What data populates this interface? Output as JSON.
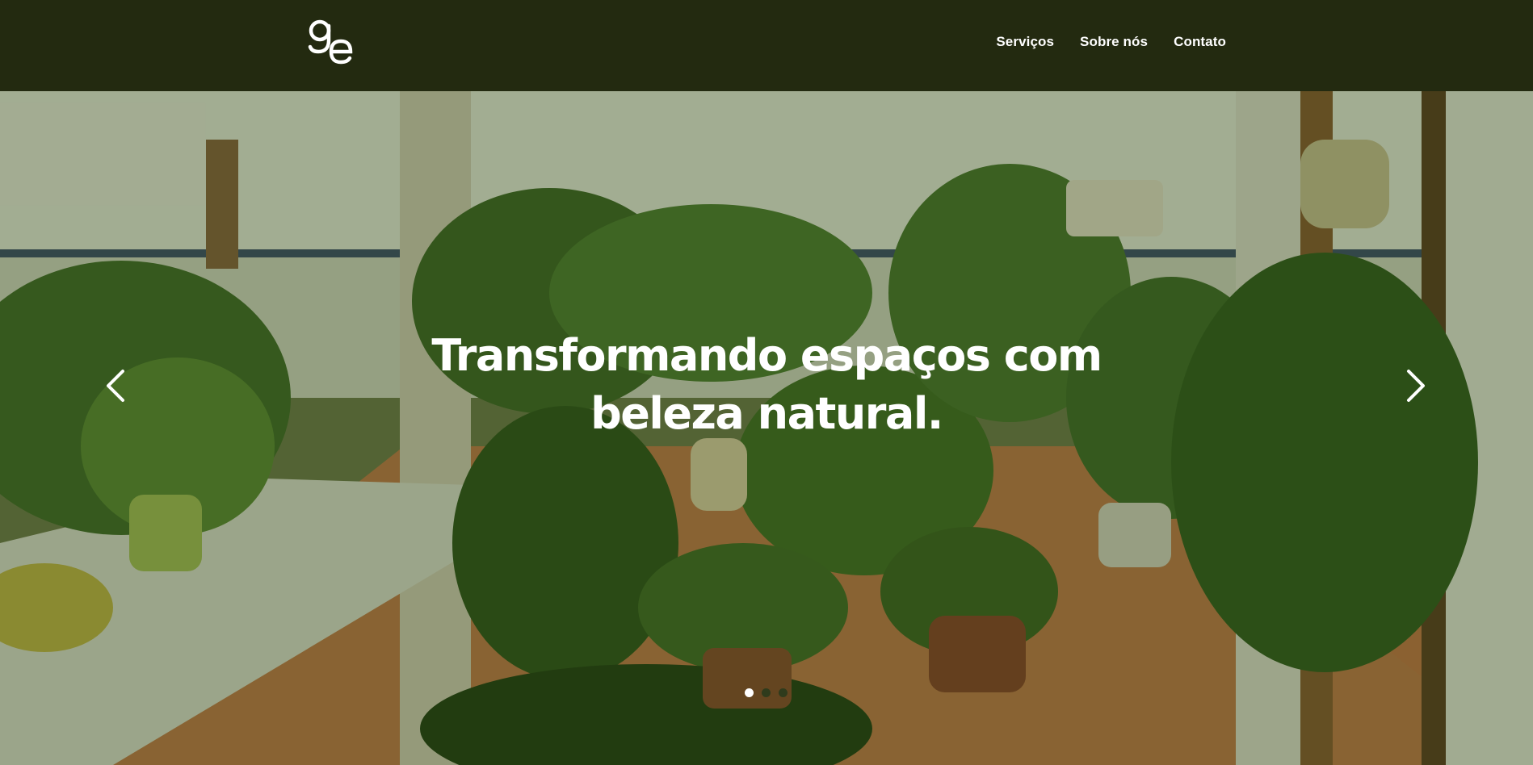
{
  "brand": {
    "logo_icon": "ge-monogram-logo",
    "nav_bg": "#232a10"
  },
  "nav": {
    "items": [
      {
        "label": "Serviços"
      },
      {
        "label": "Sobre nós"
      },
      {
        "label": "Contato"
      }
    ]
  },
  "hero": {
    "title_line1": "Transformando espaços com",
    "title_line2": "beleza natural.",
    "background_image": "courtyard-plants-photo",
    "prev_icon": "chevron-left-icon",
    "next_icon": "chevron-right-icon",
    "slides": [
      {
        "active": true
      },
      {
        "active": false
      },
      {
        "active": false
      }
    ]
  }
}
